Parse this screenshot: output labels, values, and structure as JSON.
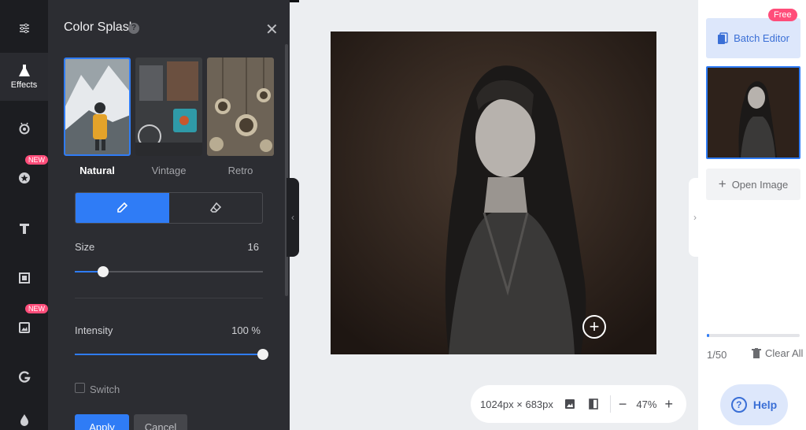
{
  "colors": {
    "accent": "#2f7cf6",
    "badge": "#ff4d7a"
  },
  "rail": {
    "items": [
      {
        "icon": "sliders-icon"
      },
      {
        "icon": "flask-icon",
        "label": "Effects",
        "active": true
      },
      {
        "icon": "eye-icon"
      },
      {
        "icon": "star-icon",
        "badge": "NEW"
      },
      {
        "icon": "text-icon"
      },
      {
        "icon": "frame-icon"
      },
      {
        "icon": "photo-icon",
        "badge": "NEW"
      },
      {
        "icon": "g-icon"
      },
      {
        "icon": "drop-icon"
      }
    ]
  },
  "panel": {
    "title": "Color Splash",
    "presets": [
      {
        "label": "Natural",
        "selected": true
      },
      {
        "label": "Vintage",
        "selected": false
      },
      {
        "label": "Retro",
        "selected": false
      }
    ],
    "size": {
      "label": "Size",
      "value": "16",
      "level": 0.15
    },
    "intensity": {
      "label": "Intensity",
      "value": "100 %",
      "level": 1.0
    },
    "switch_label": "Switch",
    "apply_label": "Apply",
    "cancel_label": "Cancel"
  },
  "canvas": {
    "dimensions": "1024px × 683px",
    "zoom": "47%"
  },
  "right": {
    "free_badge": "Free",
    "batch_label": "Batch Editor",
    "open_label": "Open Image",
    "count": "1/50",
    "progress": 0.02,
    "clear_label": "Clear All",
    "help_label": "Help"
  }
}
